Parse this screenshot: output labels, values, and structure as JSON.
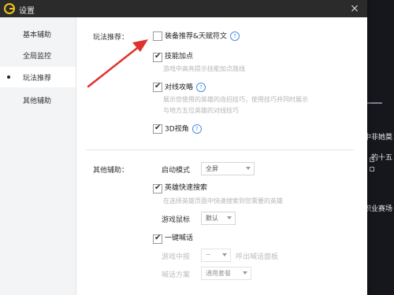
{
  "window": {
    "title": "设置",
    "close": "×"
  },
  "sidebar": {
    "items": [
      {
        "label": "基本辅助"
      },
      {
        "label": "全局监控"
      },
      {
        "label": "玩法推荐"
      },
      {
        "label": "其他辅助"
      }
    ],
    "active_index": 2
  },
  "play_recommend": {
    "section_label": "玩法推荐：",
    "items": [
      {
        "label": "装备推荐&天赋符文",
        "checked": false,
        "help": "?"
      },
      {
        "label": "技能加点",
        "checked": true,
        "desc": "游戏中高亮提示技能加点路线"
      },
      {
        "label": "对线攻略",
        "checked": true,
        "help": "?",
        "desc_lines": [
          "展示您使用的英雄的连招技巧，使用技巧并同时展示",
          "与地方五位英雄的对线技巧"
        ]
      },
      {
        "label": "3D视角",
        "checked": true,
        "help": "?"
      }
    ]
  },
  "other_assist": {
    "section_label": "其他辅助：",
    "startup_mode_label": "启动模式",
    "startup_mode_value": "全屏",
    "hero_search_label": "英雄快速搜索",
    "hero_search_checked": true,
    "hero_search_desc": "在选择英雄页面中快速搜索到您需要的英雄",
    "mouse_label": "游戏鼠标",
    "mouse_value": "默认",
    "shout_label": "一键喊话",
    "shout_checked": true,
    "shout_hotkey_prefix": "游戏中按",
    "shout_hotkey_value": "~",
    "shout_hotkey_suffix": "呼出喊话面板",
    "shout_scheme_label": "喊话方案",
    "shout_scheme_value": "通用套餐"
  },
  "background_app": {
    "text_lines": [
      "中非她莫",
      "的十五",
      "职业赛场"
    ]
  },
  "colors": {
    "titlebar": "#2b2b2b",
    "logo": "#f5c518",
    "help": "#4a90e2",
    "annotation": "#e0322d"
  }
}
